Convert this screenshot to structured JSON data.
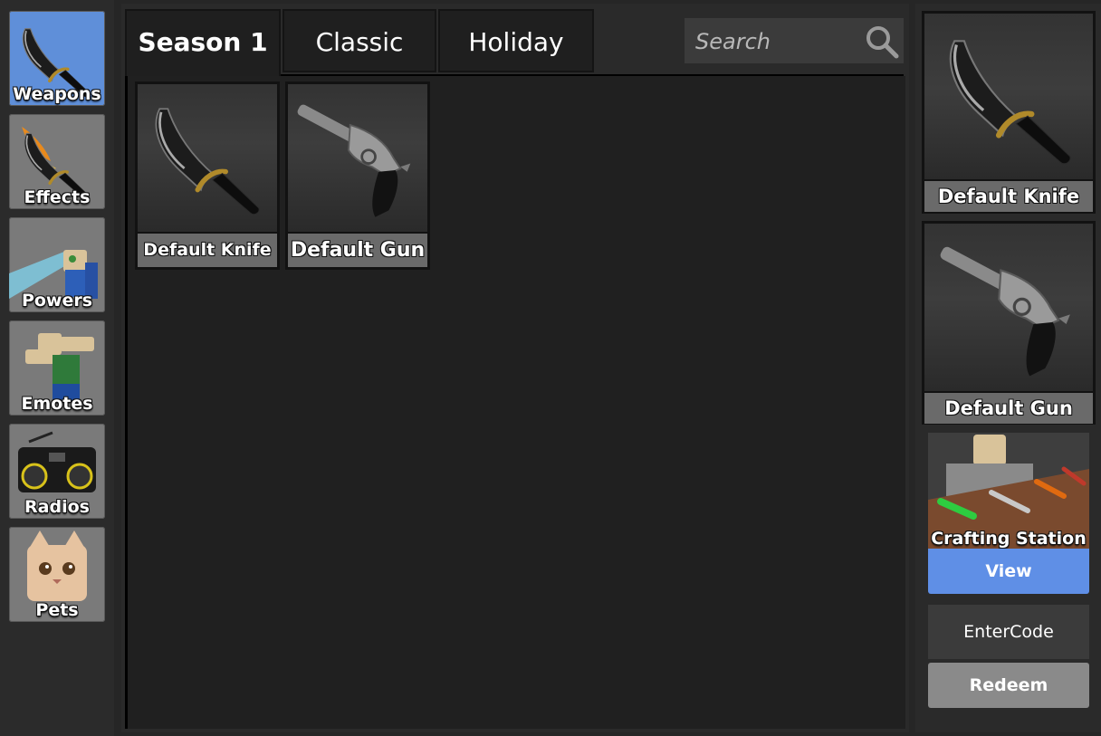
{
  "sidebar": {
    "items": [
      {
        "label": "Weapons",
        "icon": "knife-icon",
        "active": true
      },
      {
        "label": "Effects",
        "icon": "flame-knife-icon",
        "active": false
      },
      {
        "label": "Powers",
        "icon": "power-character-icon",
        "active": false
      },
      {
        "label": "Emotes",
        "icon": "emote-character-icon",
        "active": false
      },
      {
        "label": "Radios",
        "icon": "boombox-icon",
        "active": false
      },
      {
        "label": "Pets",
        "icon": "cat-icon",
        "active": false
      }
    ]
  },
  "tabs": [
    {
      "label": "Season 1",
      "active": true
    },
    {
      "label": "Classic",
      "active": false
    },
    {
      "label": "Holiday",
      "active": false
    }
  ],
  "search": {
    "placeholder": "Search",
    "value": ""
  },
  "inventory": {
    "items": [
      {
        "name": "Default Knife",
        "icon": "knife-icon"
      },
      {
        "name": "Default Gun",
        "icon": "revolver-icon"
      }
    ]
  },
  "equipped": {
    "knife": {
      "name": "Default Knife",
      "icon": "knife-icon"
    },
    "gun": {
      "name": "Default Gun",
      "icon": "revolver-icon"
    }
  },
  "crafting": {
    "label": "Crafting Station",
    "view_label": "View"
  },
  "code": {
    "placeholder": "EnterCode",
    "redeem_label": "Redeem"
  },
  "colors": {
    "accent": "#5f8fe6",
    "active_category": "#5f8fd9",
    "card_label_bg": "#6a6a6a"
  }
}
